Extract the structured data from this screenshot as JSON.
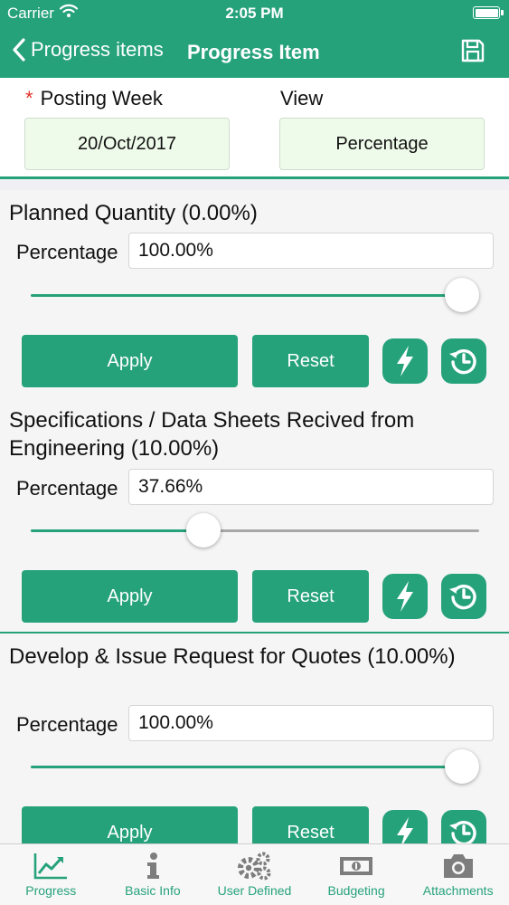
{
  "status": {
    "carrier": "Carrier",
    "time": "2:05 PM"
  },
  "nav": {
    "back_label": "Progress items",
    "title": "Progress Item"
  },
  "header": {
    "posting_week_label": "Posting Week",
    "required_mark": "*",
    "posting_week_value": "20/Oct/2017",
    "view_label": "View",
    "view_value": "Percentage"
  },
  "items": [
    {
      "title": "Planned Quantity (0.00%)",
      "percentage_label": "Percentage",
      "percentage": "100.00%",
      "slider": 1.0,
      "apply_label": "Apply",
      "reset_label": "Reset"
    },
    {
      "title": "Specifications / Data Sheets Recived from Engineering (10.00%)",
      "percentage_label": "Percentage",
      "percentage": "37.66%",
      "slider": 0.3766,
      "apply_label": "Apply",
      "reset_label": "Reset"
    },
    {
      "title": "Develop & Issue Request for Quotes (10.00%)",
      "percentage_label": "Percentage",
      "percentage": "100.00%",
      "slider": 1.0,
      "apply_label": "Apply",
      "reset_label": "Reset"
    }
  ],
  "tabbar": [
    {
      "label": "Progress",
      "icon": "chart-line-icon"
    },
    {
      "label": "Basic Info",
      "icon": "info-icon"
    },
    {
      "label": "User Defined",
      "icon": "gears-icon"
    },
    {
      "label": "Budgeting",
      "icon": "money-icon"
    },
    {
      "label": "Attachments",
      "icon": "camera-icon"
    }
  ],
  "colors": {
    "accent": "#26a27b",
    "required": "#e0322a",
    "field_bg": "#effbea",
    "track": "#a8a8a8"
  }
}
